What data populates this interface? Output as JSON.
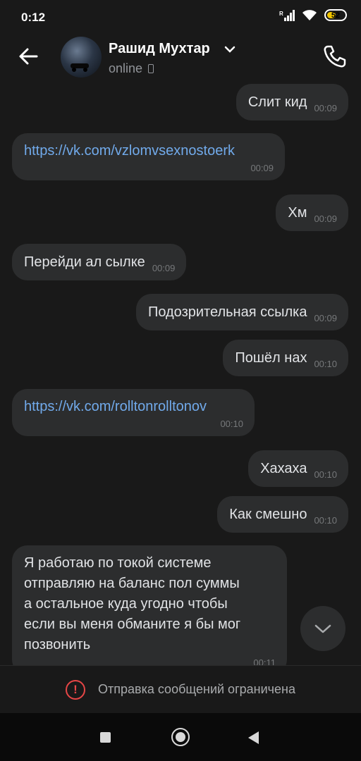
{
  "status_bar": {
    "time": "0:12",
    "network_label": "R",
    "battery": "52",
    "battery_level": 0.52
  },
  "header": {
    "contact_name": "Рашид Мухтар",
    "status": "online"
  },
  "messages": [
    {
      "side": "out",
      "text": "Слит кид",
      "time": "00:09"
    },
    {
      "side": "in",
      "text": "https://vk.com/vzlomvsexnostoerk",
      "time": "00:09",
      "is_link": true
    },
    {
      "side": "out",
      "text": "Хм",
      "time": "00:09"
    },
    {
      "side": "in",
      "text": "Перейди ал сылке",
      "time": "00:09"
    },
    {
      "side": "out",
      "text": "Подозрительная ссылка",
      "time": "00:09"
    },
    {
      "side": "out",
      "text": "Пошёл нах",
      "time": "00:10"
    },
    {
      "side": "in",
      "text": "https://vk.com/rolltonrolltonov",
      "time": "00:10",
      "is_link": true
    },
    {
      "side": "out",
      "text": "Хахаха",
      "time": "00:10"
    },
    {
      "side": "out",
      "text": "Как смешно",
      "time": "00:10"
    },
    {
      "side": "in",
      "lines": [
        "Я работаю по токой системе",
        "отправляю на баланс пол суммы",
        "а остальное куда угодно чтобы",
        "если вы меня обманите я бы мог",
        "позвонить"
      ],
      "time": "00:11"
    }
  ],
  "footer": {
    "restriction_text": "Отправка сообщений ограничена"
  },
  "colors": {
    "background": "#191919",
    "bubble": "#2c2d2e",
    "link": "#71aaeb",
    "warning": "#e64646"
  }
}
